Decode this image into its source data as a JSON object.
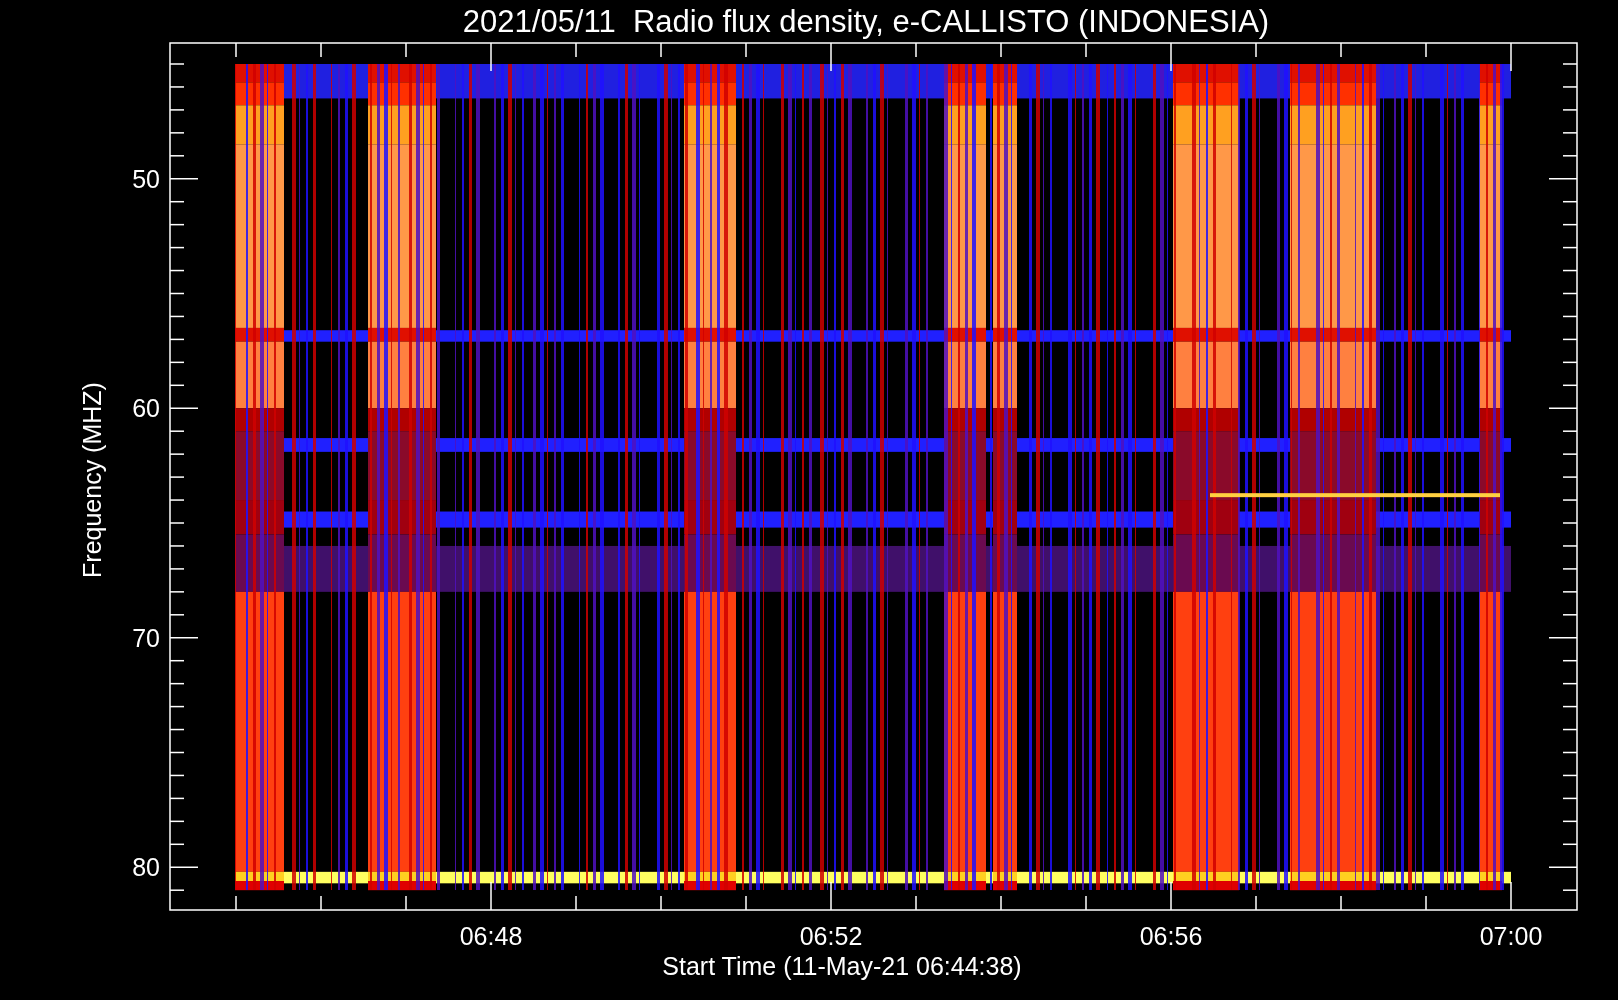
{
  "title": "2021/05/11  Radio flux density, e-CALLISTO (INDONESIA)",
  "y_axis": {
    "label": "Frequency (MHZ)",
    "ticks": [
      "50",
      "60",
      "70",
      "80"
    ]
  },
  "x_axis": {
    "label": "Start Time (11-May-21 06:44:38)",
    "ticks": [
      "06:48",
      "06:52",
      "06:56",
      "07:00"
    ]
  }
}
